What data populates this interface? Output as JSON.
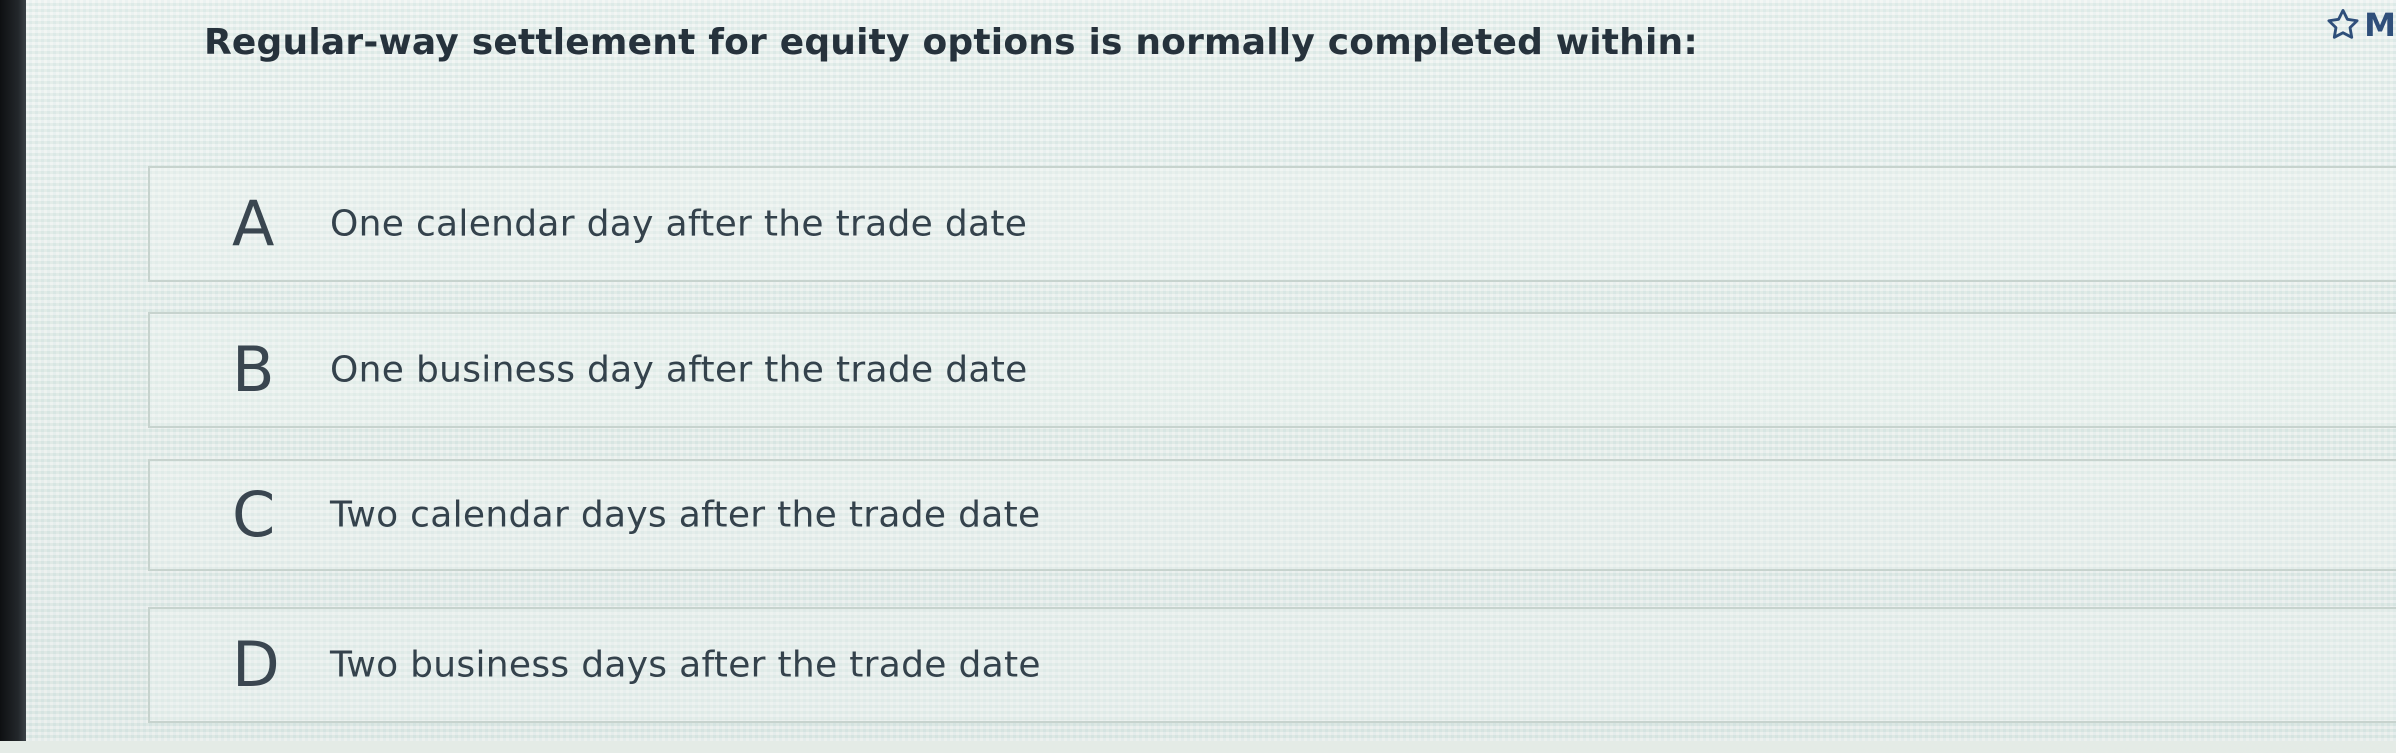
{
  "question": {
    "text": "Regular-way settlement for equity options is normally completed within:"
  },
  "mark_button": {
    "icon": "star-outline-icon",
    "label": "M"
  },
  "options": [
    {
      "letter": "A",
      "text": "One calendar day after the trade date"
    },
    {
      "letter": "B",
      "text": "One business day after the trade date"
    },
    {
      "letter": "C",
      "text": "Two calendar days after the trade date"
    },
    {
      "letter": "D",
      "text": "Two business days after the trade date"
    }
  ],
  "colors": {
    "text": "#26323c",
    "accent": "#2f4f7a",
    "border": "#c7d3ce",
    "background": "#e4ebe6"
  }
}
